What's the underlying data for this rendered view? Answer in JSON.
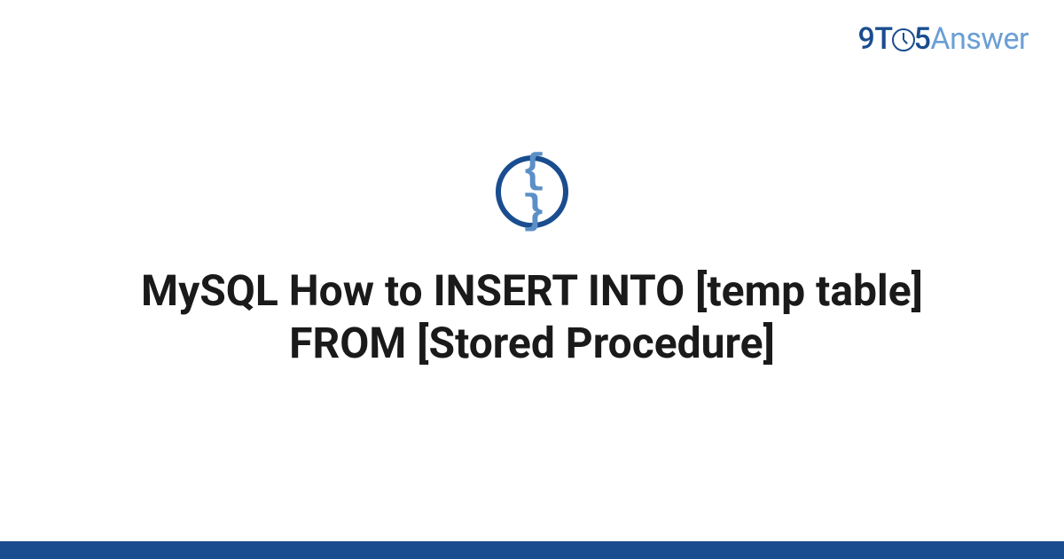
{
  "brand": {
    "part1": "9T",
    "part2": "5",
    "part3": "Answer"
  },
  "icon": {
    "glyph": "{ }",
    "name": "code-braces-icon"
  },
  "title": "MySQL How to INSERT INTO [temp table] FROM [Stored Procedure]",
  "colors": {
    "primary": "#1a4d8f",
    "accent": "#5b8fc7",
    "text": "#1a1a1a"
  }
}
